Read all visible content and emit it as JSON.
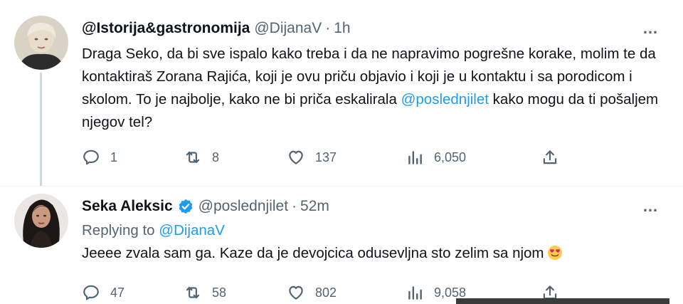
{
  "tweet1": {
    "name": "@Istorija&gastronomija",
    "handle": "@DijanaV",
    "separator": "·",
    "time": "1h",
    "text_before_mention": "Draga Seko, da bi sve ispalo kako treba i da ne napravimo pogrešne korake, molim te da kontaktiraš Zorana Rajića, koji je ovu priču objavio i koji je u kontaktu i sa porodicom i skolom. To je najbolje, kako ne bi priča eskalirala ",
    "mention": "@poslednjilet",
    "text_after_mention": " kako mogu da ti pošaljem njegov tel?",
    "stats": {
      "replies": "1",
      "retweets": "8",
      "likes": "137",
      "views": "6,050"
    }
  },
  "tweet2": {
    "name": "Seka Aleksic",
    "verified": true,
    "handle": "@poslednjilet",
    "separator": "·",
    "time": "52m",
    "replying_prefix": "Replying to ",
    "replying_to": "@DijanaV",
    "text": "Jeeee zvala sam ga. Kaze da je devojcica odusevljna sto zelim sa njom",
    "emoji": "smiling-face-with-heart-eyes-emoji",
    "stats": {
      "replies": "47",
      "retweets": "58",
      "likes": "802",
      "views": "9,058"
    }
  },
  "icons": {
    "more": "…",
    "reply": "reply-icon",
    "retweet": "retweet-icon",
    "like": "heart-icon",
    "views": "views-icon",
    "share": "share-icon"
  },
  "colors": {
    "link": "#1d9bf0",
    "muted": "#536471",
    "text": "#0f1419",
    "verified": "#1d9bf0"
  }
}
